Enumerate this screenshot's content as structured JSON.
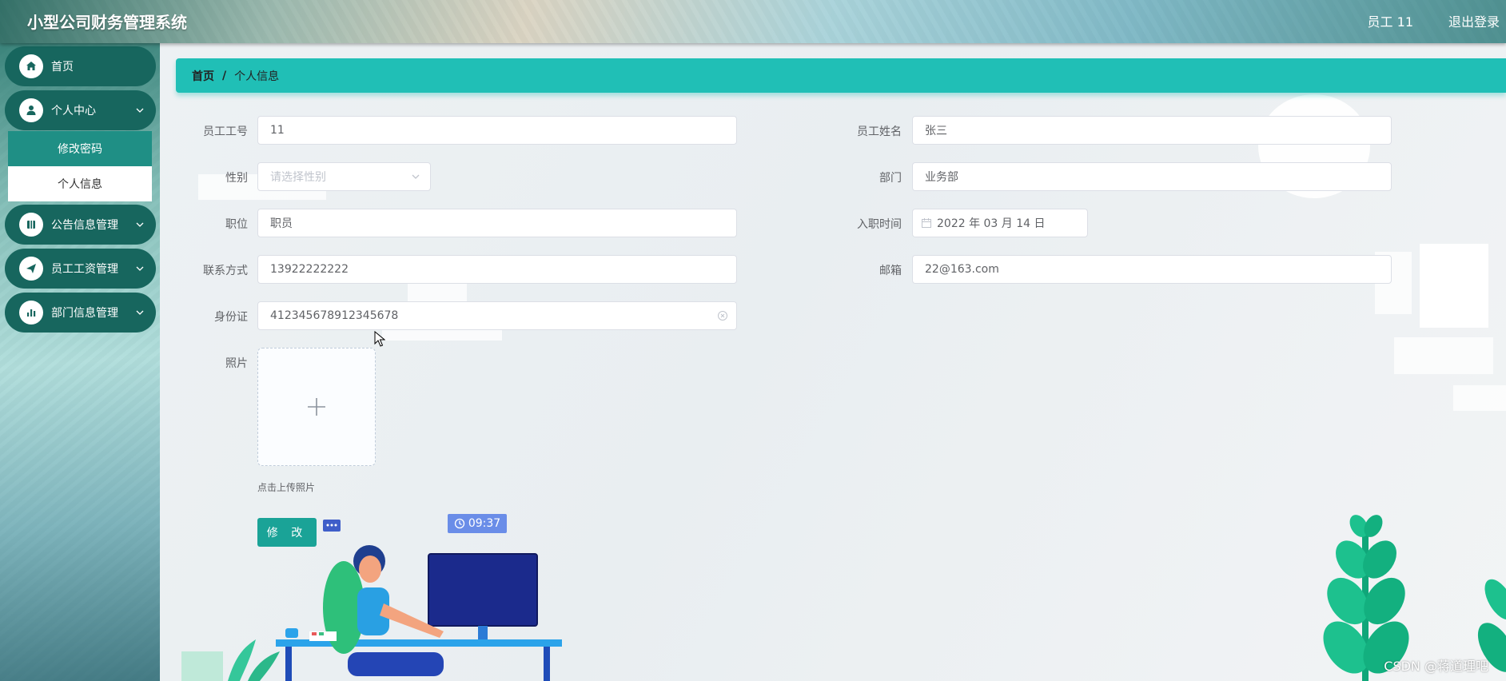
{
  "header": {
    "title": "小型公司财务管理系统",
    "user": "员工 11",
    "logout": "退出登录"
  },
  "sidebar": {
    "items": [
      {
        "label": "首页",
        "icon": "home-icon"
      },
      {
        "label": "个人中心",
        "icon": "user-icon"
      },
      {
        "label": "公告信息管理",
        "icon": "notice-icon"
      },
      {
        "label": "员工工资管理",
        "icon": "paper-plane-icon"
      },
      {
        "label": "部门信息管理",
        "icon": "bar-chart-icon"
      }
    ],
    "submenu": [
      {
        "label": "修改密码",
        "active": true
      },
      {
        "label": "个人信息",
        "active": false
      }
    ]
  },
  "breadcrumb": {
    "home": "首页",
    "separator": "/",
    "current": "个人信息"
  },
  "form": {
    "employee_id": {
      "label": "员工工号",
      "value": "11"
    },
    "employee_name": {
      "label": "员工姓名",
      "value": "张三"
    },
    "gender": {
      "label": "性别",
      "placeholder": "请选择性别"
    },
    "department": {
      "label": "部门",
      "value": "业务部"
    },
    "position": {
      "label": "职位",
      "value": "职员"
    },
    "hire_date": {
      "label": "入职时间",
      "value": "2022 年 03 月 14 日"
    },
    "phone": {
      "label": "联系方式",
      "value": "13922222222"
    },
    "email": {
      "label": "邮箱",
      "value": "22@163.com"
    },
    "id_card": {
      "label": "身份证",
      "value": "412345678912345678"
    },
    "photo": {
      "label": "照片",
      "hint": "点击上传照片"
    },
    "submit": "修 改"
  },
  "decor": {
    "clock": "09:37"
  },
  "watermark": "CSDN @蒋道理吧",
  "colors": {
    "accent": "#20bfb6",
    "button": "#1aa397",
    "menu": "#17665e"
  }
}
